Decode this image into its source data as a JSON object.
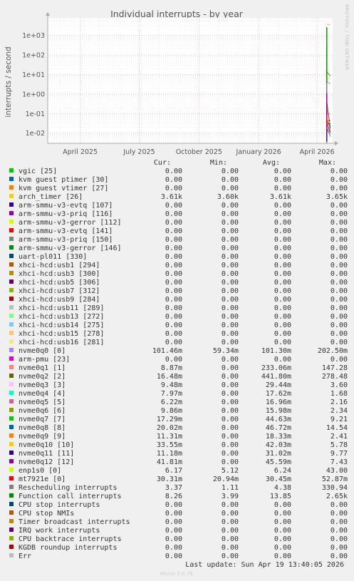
{
  "side_label": "RRDTOOL / TOBI OETIKER",
  "footer": {
    "last_update": "Last update: Sun Apr 19 13:40:05 2026",
    "version": "Munin 2.0.76"
  },
  "chart_data": {
    "type": "line",
    "title": "Individual interrupts - by year",
    "ylabel": "interrupts / second",
    "y_scale": "log",
    "ylim": [
      0.003,
      8000
    ],
    "y_ticks": [
      {
        "value": 0.01,
        "label": "1e-02"
      },
      {
        "value": 0.1,
        "label": "1e-01"
      },
      {
        "value": 1,
        "label": "1e+00"
      },
      {
        "value": 10,
        "label": "1e+01"
      },
      {
        "value": 100,
        "label": "1e+02"
      },
      {
        "value": 1000,
        "label": "1e+03"
      }
    ],
    "x_range": [
      "2025-02-10",
      "2026-04-25"
    ],
    "x_ticks": [
      {
        "date": "2025-04-01",
        "label": "April 2025"
      },
      {
        "date": "2025-07-01",
        "label": "July 2025"
      },
      {
        "date": "2025-10-01",
        "label": "October 2025"
      },
      {
        "date": "2026-01-01",
        "label": "January 2026"
      },
      {
        "date": "2026-04-01",
        "label": "April 2026"
      }
    ],
    "grid": true,
    "data_start": "2026-04-16",
    "columns": [
      "Cur:",
      "Min:",
      "Avg:",
      "Max:"
    ],
    "series": [
      {
        "name": "vgic [25]",
        "color": "#00cc00",
        "cur": "0.00",
        "min": "0.00",
        "avg": "0.00",
        "max": "0.00"
      },
      {
        "name": "kvm guest ptimer [30]",
        "color": "#0066b3",
        "cur": "0.00",
        "min": "0.00",
        "avg": "0.00",
        "max": "0.00"
      },
      {
        "name": "kvm guest vtimer [27]",
        "color": "#ff8000",
        "cur": "0.00",
        "min": "0.00",
        "avg": "0.00",
        "max": "0.00"
      },
      {
        "name": "arch_timer [26]",
        "color": "#ffcc00",
        "cur": "3.61k",
        "min": "3.60k",
        "avg": "3.61k",
        "max": "3.65k"
      },
      {
        "name": "arm-smmu-v3-evtq [107]",
        "color": "#330099",
        "cur": "0.00",
        "min": "0.00",
        "avg": "0.00",
        "max": "0.00"
      },
      {
        "name": "arm-smmu-v3-priq [116]",
        "color": "#990099",
        "cur": "0.00",
        "min": "0.00",
        "avg": "0.00",
        "max": "0.00"
      },
      {
        "name": "arm-smmu-v3-gerror [112]",
        "color": "#ccff00",
        "cur": "0.00",
        "min": "0.00",
        "avg": "0.00",
        "max": "0.00"
      },
      {
        "name": "arm-smmu-v3-evtq [141]",
        "color": "#ff0000",
        "cur": "0.00",
        "min": "0.00",
        "avg": "0.00",
        "max": "0.00"
      },
      {
        "name": "arm-smmu-v3-priq [150]",
        "color": "#808080",
        "cur": "0.00",
        "min": "0.00",
        "avg": "0.00",
        "max": "0.00"
      },
      {
        "name": "arm-smmu-v3-gerror [146]",
        "color": "#008f00",
        "cur": "0.00",
        "min": "0.00",
        "avg": "0.00",
        "max": "0.00"
      },
      {
        "name": "uart-pl011 [330]",
        "color": "#00487d",
        "cur": "0.00",
        "min": "0.00",
        "avg": "0.00",
        "max": "0.00"
      },
      {
        "name": "xhci-hcd:usb1 [294]",
        "color": "#b35a00",
        "cur": "0.00",
        "min": "0.00",
        "avg": "0.00",
        "max": "0.00"
      },
      {
        "name": "xhci-hcd:usb3 [300]",
        "color": "#b38f00",
        "cur": "0.00",
        "min": "0.00",
        "avg": "0.00",
        "max": "0.00"
      },
      {
        "name": "xhci-hcd:usb5 [306]",
        "color": "#6b006b",
        "cur": "0.00",
        "min": "0.00",
        "avg": "0.00",
        "max": "0.00"
      },
      {
        "name": "xhci-hcd:usb7 [312]",
        "color": "#8fb300",
        "cur": "0.00",
        "min": "0.00",
        "avg": "0.00",
        "max": "0.00"
      },
      {
        "name": "xhci-hcd:usb9 [284]",
        "color": "#b30000",
        "cur": "0.00",
        "min": "0.00",
        "avg": "0.00",
        "max": "0.00"
      },
      {
        "name": "xhci-hcd:usb11 [289]",
        "color": "#bebebe",
        "cur": "0.00",
        "min": "0.00",
        "avg": "0.00",
        "max": "0.00"
      },
      {
        "name": "xhci-hcd:usb13 [272]",
        "color": "#80ff80",
        "cur": "0.00",
        "min": "0.00",
        "avg": "0.00",
        "max": "0.00"
      },
      {
        "name": "xhci-hcd:usb14 [275]",
        "color": "#80c9ff",
        "cur": "0.00",
        "min": "0.00",
        "avg": "0.00",
        "max": "0.00"
      },
      {
        "name": "xhci-hcd:usb15 [278]",
        "color": "#ffc080",
        "cur": "0.00",
        "min": "0.00",
        "avg": "0.00",
        "max": "0.00"
      },
      {
        "name": "xhci-hcd:usb16 [281]",
        "color": "#ffe680",
        "cur": "0.00",
        "min": "0.00",
        "avg": "0.00",
        "max": "0.00"
      },
      {
        "name": "nvme0q0 [0]",
        "color": "#aa80ff",
        "cur": "101.46m",
        "min": "59.34m",
        "avg": "101.30m",
        "max": "202.50m"
      },
      {
        "name": "arm-pmu [23]",
        "color": "#ee00cc",
        "cur": "0.00",
        "min": "0.00",
        "avg": "0.00",
        "max": "0.00"
      },
      {
        "name": "nvme0q1 [1]",
        "color": "#ff8080",
        "cur": "8.87m",
        "min": "0.00",
        "avg": "233.06m",
        "max": "147.28"
      },
      {
        "name": "nvme0q2 [2]",
        "color": "#666600",
        "cur": "16.48m",
        "min": "0.00",
        "avg": "441.80m",
        "max": "278.48"
      },
      {
        "name": "nvme0q3 [3]",
        "color": "#ffbfff",
        "cur": "9.48m",
        "min": "0.00",
        "avg": "29.44m",
        "max": "3.60"
      },
      {
        "name": "nvme0q4 [4]",
        "color": "#00ffcc",
        "cur": "7.97m",
        "min": "0.00",
        "avg": "17.62m",
        "max": "1.68"
      },
      {
        "name": "nvme0q5 [5]",
        "color": "#cc6699",
        "cur": "6.22m",
        "min": "0.00",
        "avg": "16.96m",
        "max": "2.16"
      },
      {
        "name": "nvme0q6 [6]",
        "color": "#999900",
        "cur": "9.86m",
        "min": "0.00",
        "avg": "15.98m",
        "max": "2.34"
      },
      {
        "name": "nvme0q7 [7]",
        "color": "#00cc00",
        "cur": "17.29m",
        "min": "0.00",
        "avg": "44.63m",
        "max": "9.21"
      },
      {
        "name": "nvme0q8 [8]",
        "color": "#0066b3",
        "cur": "20.02m",
        "min": "0.00",
        "avg": "46.72m",
        "max": "14.54"
      },
      {
        "name": "nvme0q9 [9]",
        "color": "#ff8000",
        "cur": "11.31m",
        "min": "0.00",
        "avg": "18.33m",
        "max": "2.41"
      },
      {
        "name": "nvme0q10 [10]",
        "color": "#ffcc00",
        "cur": "33.55m",
        "min": "0.00",
        "avg": "42.03m",
        "max": "5.78"
      },
      {
        "name": "nvme0q11 [11]",
        "color": "#330099",
        "cur": "11.18m",
        "min": "0.00",
        "avg": "31.02m",
        "max": "9.77"
      },
      {
        "name": "nvme0q12 [12]",
        "color": "#990099",
        "cur": "41.81m",
        "min": "0.00",
        "avg": "45.59m",
        "max": "7.43"
      },
      {
        "name": "enp1s0 [0]",
        "color": "#ccff00",
        "cur": "6.17",
        "min": "5.12",
        "avg": "6.24",
        "max": "43.00"
      },
      {
        "name": "mt7921e [0]",
        "color": "#ff0000",
        "cur": "30.31m",
        "min": "20.94m",
        "avg": "30.45m",
        "max": "52.87m"
      },
      {
        "name": "Rescheduling interrupts",
        "color": "#808080",
        "cur": "3.37",
        "min": "1.11",
        "avg": "4.38",
        "max": "330.94"
      },
      {
        "name": "Function call interrupts",
        "color": "#008f00",
        "cur": "8.26",
        "min": "3.99",
        "avg": "13.85",
        "max": "2.65k"
      },
      {
        "name": "CPU stop interrupts",
        "color": "#00487d",
        "cur": "0.00",
        "min": "0.00",
        "avg": "0.00",
        "max": "0.00"
      },
      {
        "name": "CPU stop NMIs",
        "color": "#b35a00",
        "cur": "0.00",
        "min": "0.00",
        "avg": "0.00",
        "max": "0.00"
      },
      {
        "name": "Timer broadcast interrupts",
        "color": "#b38f00",
        "cur": "0.00",
        "min": "0.00",
        "avg": "0.00",
        "max": "0.00"
      },
      {
        "name": "IRQ work interrupts",
        "color": "#6b006b",
        "cur": "0.00",
        "min": "0.00",
        "avg": "0.00",
        "max": "0.00"
      },
      {
        "name": "CPU backtrace interrupts",
        "color": "#8fb300",
        "cur": "0.00",
        "min": "0.00",
        "avg": "0.00",
        "max": "0.00"
      },
      {
        "name": "KGDB roundup interrupts",
        "color": "#b30000",
        "cur": "0.00",
        "min": "0.00",
        "avg": "0.00",
        "max": "0.00"
      },
      {
        "name": "Err",
        "color": "#bebebe",
        "cur": "0.00",
        "min": "0.00",
        "avg": "0.00",
        "max": "0.00"
      }
    ]
  }
}
